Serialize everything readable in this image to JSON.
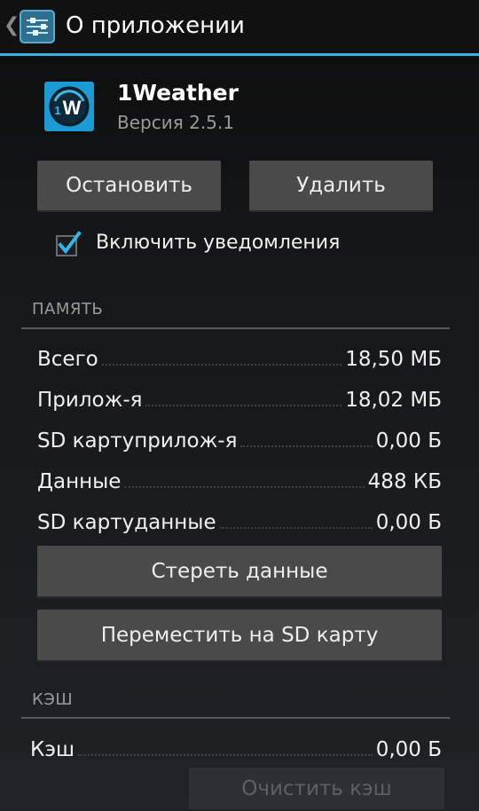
{
  "action_bar": {
    "title": "О приложении"
  },
  "app": {
    "name": "1Weather",
    "version": "Версия 2.5.1",
    "icon_text": "W",
    "icon_badge": "1"
  },
  "controls": {
    "stop_label": "Остановить",
    "uninstall_label": "Удалить",
    "notifications_label": "Включить уведомления",
    "notifications_checked": true
  },
  "storage": {
    "header": "ПАМЯТЬ",
    "rows": [
      {
        "label": "Всего",
        "value": "18,50 МБ"
      },
      {
        "label": "Прилож-я",
        "value": "18,02 МБ"
      },
      {
        "label": "SD картуприлож-я",
        "value": "0,00 Б"
      },
      {
        "label": "Данные",
        "value": "488 КБ"
      },
      {
        "label": "SD картуданные",
        "value": "0,00 Б"
      }
    ],
    "clear_data_label": "Стереть данные",
    "move_sd_label": "Переместить на SD карту"
  },
  "cache": {
    "header": "КЭШ",
    "label": "Кэш",
    "value": "0,00 Б",
    "clear_cache_label": "Очистить кэш"
  },
  "colors": {
    "accent": "#33b5e5",
    "button": "#4a4a4a",
    "icon_bg": "#1b9bd3"
  }
}
